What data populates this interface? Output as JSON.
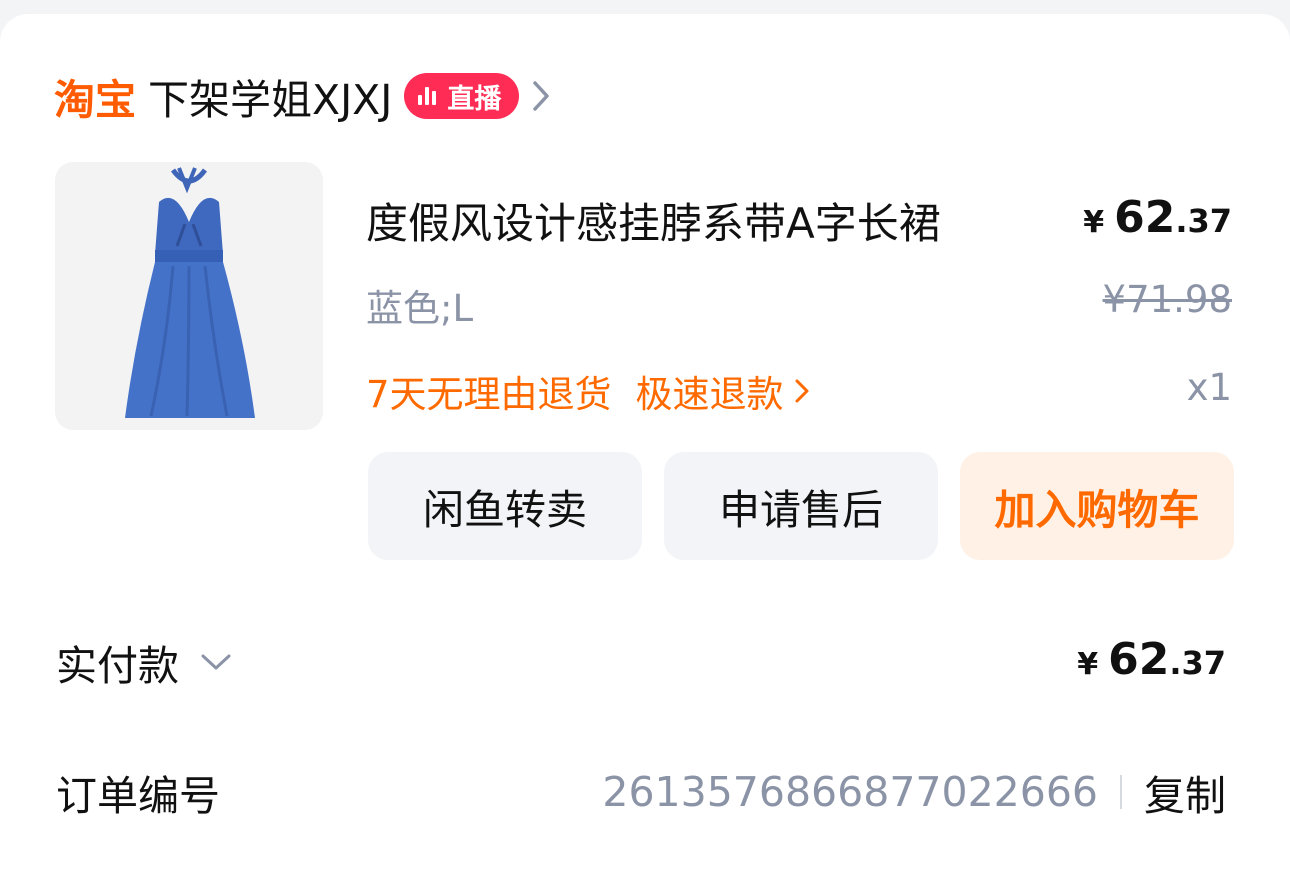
{
  "store": {
    "platform_logo": "淘宝",
    "name": "下架学姐XJXJ",
    "live_badge": "直播",
    "chevron_icon": "chevron-right-icon"
  },
  "product": {
    "title": "度假风设计感挂脖系带A字长裙",
    "price_currency": "¥",
    "price_integer": "62",
    "price_decimal": ".37",
    "sku": "蓝色;L",
    "original_price": "¥71.98",
    "quantity": "x1",
    "service_returns": "7天无理由退货",
    "service_refund": "极速退款",
    "image_desc_icon": "blue-halter-dress-image"
  },
  "actions": {
    "resell": "闲鱼转卖",
    "after_sale": "申请售后",
    "add_to_cart": "加入购物车"
  },
  "payment": {
    "label": "实付款",
    "currency": "¥",
    "amount_integer": "62",
    "amount_decimal": ".37"
  },
  "order": {
    "label": "订单编号",
    "number": "2613576866877022666",
    "copy": "复制"
  },
  "colors": {
    "brand_orange": "#ff6a00",
    "live_red": "#ff2d55",
    "muted_text": "#8b93a6",
    "button_gray": "#f2f4f7",
    "button_orange_bg": "#fff1e6"
  }
}
